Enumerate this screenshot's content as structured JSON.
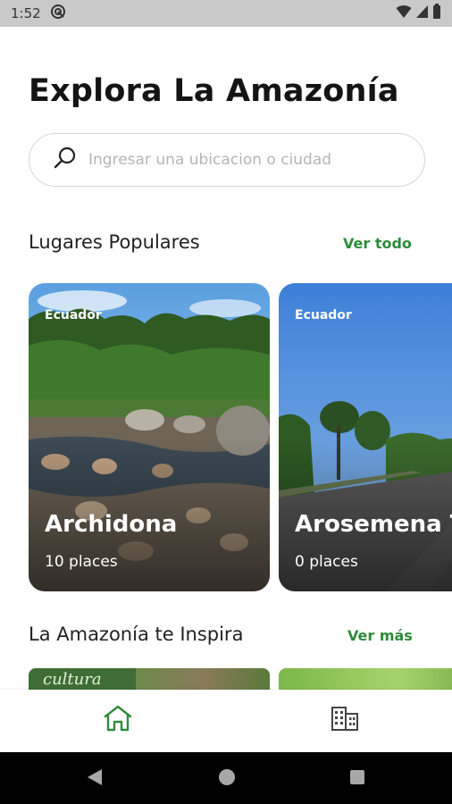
{
  "status_bar": {
    "time": "1:52"
  },
  "header": {
    "title": "Explora La Amazonía"
  },
  "search": {
    "placeholder": "Ingresar una ubicacion o ciudad"
  },
  "popular": {
    "title": "Lugares Populares",
    "see_all": "Ver todo",
    "cards": [
      {
        "country": "Ecuador",
        "name": "Archidona",
        "places": "10 places"
      },
      {
        "country": "Ecuador",
        "name": "Arosemena Tola",
        "places": "0 places"
      }
    ]
  },
  "inspire": {
    "title": "La Amazonía te Inspira",
    "see_more": "Ver más",
    "thumb_text": "cultura"
  },
  "bottom_nav": {
    "items": [
      {
        "icon": "home-icon",
        "active": true
      },
      {
        "icon": "buildings-icon",
        "active": false
      }
    ]
  },
  "colors": {
    "accent": "#2e8b3a",
    "status_bar": "#c9c9c9",
    "system_nav": "#000000"
  }
}
